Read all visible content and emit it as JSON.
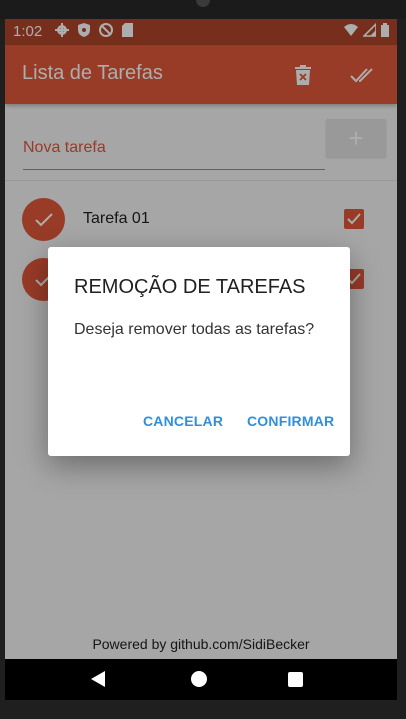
{
  "status_bar": {
    "time": "1:02",
    "left_icons": [
      "gear-icon",
      "shield-icon",
      "no-sync-icon",
      "sd-card-icon"
    ],
    "right_icons": [
      "wifi-icon",
      "signal-icon",
      "battery-icon"
    ]
  },
  "app_bar": {
    "title": "Lista de Tarefas",
    "actions": [
      "delete-all-icon",
      "check-all-icon"
    ]
  },
  "new_task": {
    "placeholder": "Nova tarefa",
    "add_label": "+"
  },
  "tasks": [
    {
      "label": "Tarefa 01",
      "done": true
    },
    {
      "label": "",
      "done": true
    }
  ],
  "footer": {
    "text": "Powered by github.com/SidiBecker"
  },
  "dialog": {
    "title": "REMOÇÃO DE TAREFAS",
    "message": "Deseja remover todas as tarefas?",
    "cancel_label": "CANCELAR",
    "confirm_label": "CONFIRMAR"
  },
  "colors": {
    "primary": "#e0573a",
    "primary_dark": "#b0452a",
    "dialog_button": "#2f8fdd"
  }
}
